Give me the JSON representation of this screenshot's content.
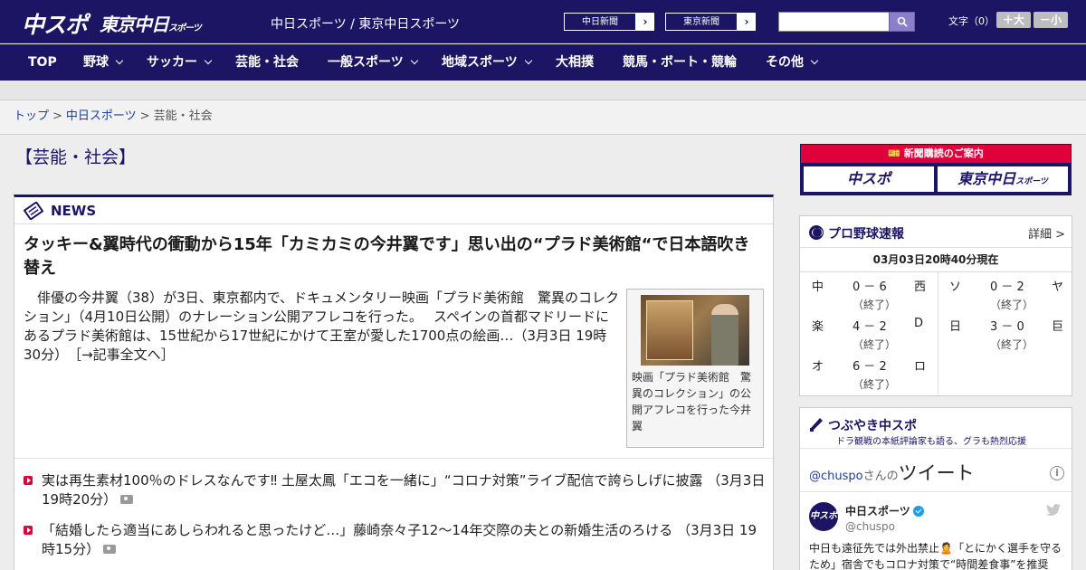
{
  "header": {
    "logo_chuspo": "中スポ",
    "logo_tokyo": "東京中日",
    "logo_tokyo_small": "スポーツ",
    "site_title": "中日スポーツ / 東京中日スポーツ",
    "paper_links": [
      "中日新聞",
      "東京新聞"
    ],
    "search_placeholder": "",
    "font_size_label": "文字（0）",
    "font_bigger": "＋大",
    "font_smaller": "－小",
    "colors": {
      "primary": "#1c1564",
      "accent": "#e0003c"
    }
  },
  "nav": {
    "items": [
      {
        "label": "TOP",
        "dropdown": false
      },
      {
        "label": "野球",
        "dropdown": true
      },
      {
        "label": "サッカー",
        "dropdown": true
      },
      {
        "label": "芸能・社会",
        "dropdown": false
      },
      {
        "label": "一般スポーツ",
        "dropdown": true
      },
      {
        "label": "地域スポーツ",
        "dropdown": true
      },
      {
        "label": "大相撲",
        "dropdown": false
      },
      {
        "label": "競馬・ボート・競輪",
        "dropdown": false
      },
      {
        "label": "その他",
        "dropdown": true
      }
    ]
  },
  "breadcrumb": {
    "items": [
      "トップ",
      "中日スポーツ",
      "芸能・社会"
    ],
    "separator": ">"
  },
  "page": {
    "title": "【芸能・社会】"
  },
  "news": {
    "heading": "NEWS",
    "headline": "タッキー&翼時代の衝動から15年「カミカミの今井翼です」思い出の“プラド美術館“で日本語吹き替え",
    "lead": "　俳優の今井翼（38）が3日、東京都内で、ドキュメンタリー映画「プラド美術館　驚異のコレクション」（4月10日公開）のナレーション公開アフレコを行った。　 スペインの首都マドリードにあるプラド美術館は、15世紀から17世紀にかけて王室が愛した1700点の絵画…（3月3日 19時30分）",
    "more_link": "［→記事全文へ］",
    "photo_caption": "映画「プラド美術館　驚異のコレクション」の公開アフレコを行った今井翼",
    "list": [
      {
        "text": "実は再生素材100％のドレスなんです‼ 土屋太鳳「エコを一緒に」“コロナ対策”ライブ配信で誇らしげに披露",
        "time": "（3月3日 19時20分）",
        "photo_icon": "camera-icon"
      },
      {
        "text": "「結婚したら適当にあしらわれると思ったけど…」藤崎奈々子12～14年交際の夫との新婚生活のろける",
        "time": "（3月3日 19時15分）",
        "photo_icon": "camera-icon"
      }
    ]
  },
  "subscription": {
    "heading": "新聞購読のご案内",
    "btn_chuspo": "中スポ",
    "btn_tokyo": "東京中日",
    "btn_tokyo_small": "スポーツ"
  },
  "baseball": {
    "title": "プロ野球速報",
    "detail_link": "詳細 >",
    "timestamp": "03月03日20時40分現在",
    "games": [
      {
        "team1": "中",
        "score": "0 － 6",
        "team2": "西",
        "status": "（終了）"
      },
      {
        "team1": "ソ",
        "score": "0 － 2",
        "team2": "ヤ",
        "status": "（終了）"
      },
      {
        "team1": "楽",
        "score": "4 － 2",
        "team2": "D",
        "status": "（終了）"
      },
      {
        "team1": "日",
        "score": "3 － 0",
        "team2": "巨",
        "status": "（終了）"
      },
      {
        "team1": "オ",
        "score": "6 － 2",
        "team2": "ロ",
        "status": "（終了）"
      }
    ]
  },
  "twitter": {
    "title": "つぶやき中スポ",
    "subtitle": "ドラ観戦の本紙評論家も語る、グラも熱烈応援",
    "handle_link": "@chuspo",
    "handle_suffix": "さんの",
    "tweet_label": "ツイート",
    "info": "i",
    "account_name": "中日スポーツ",
    "account_id": "@chuspo",
    "avatar_text": "中スポ",
    "tweet_text": "中日も遠征先では外出禁止🙎「とにかく選手を守るため」宿舎でもコロナ対策で“時間差食事”を推奨"
  }
}
